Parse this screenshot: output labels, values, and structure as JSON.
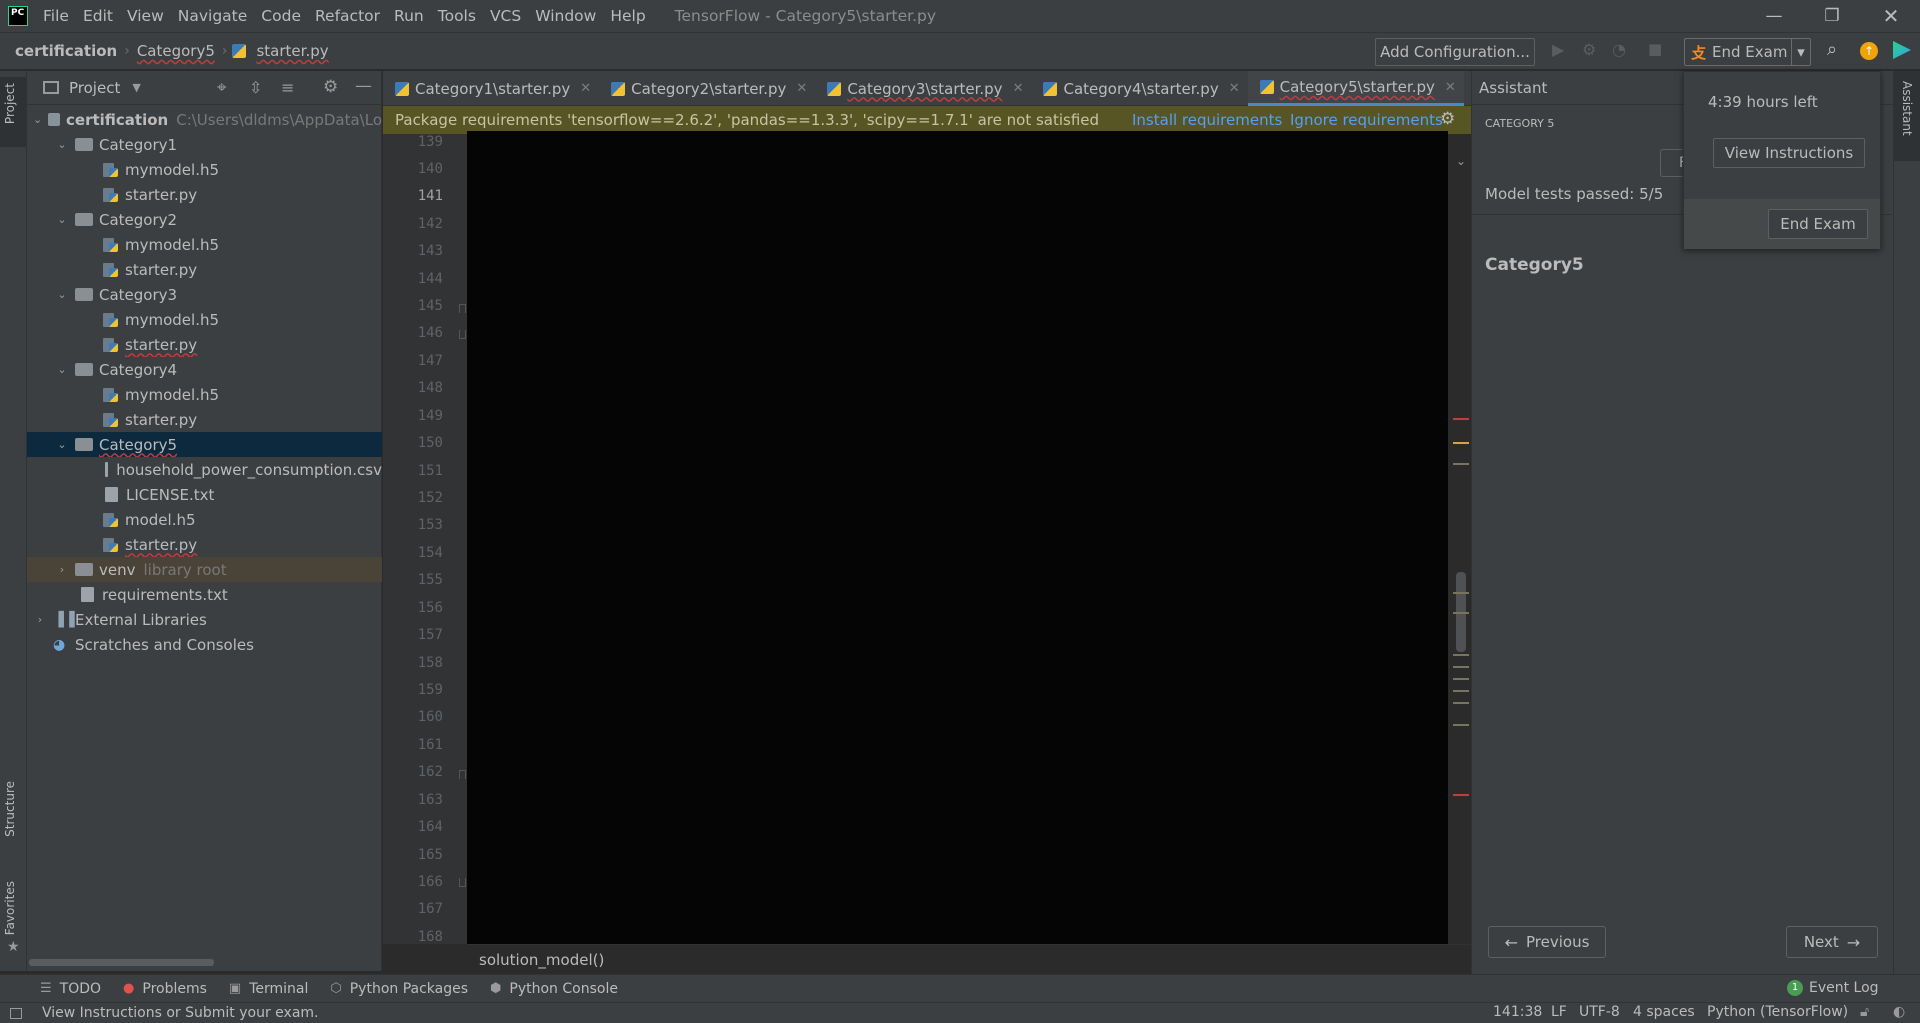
{
  "app": {
    "logo_text": "PC",
    "window_title": "TensorFlow - Category5\\starter.py",
    "menu": [
      "File",
      "Edit",
      "View",
      "Navigate",
      "Code",
      "Refactor",
      "Run",
      "Tools",
      "VCS",
      "Window",
      "Help"
    ]
  },
  "navbar": {
    "crumbs": [
      "certification",
      "Category5",
      "starter.py"
    ],
    "add_configuration": "Add Configuration...",
    "end_exam": "End Exam"
  },
  "left_strip": {
    "project": "Project",
    "structure": "Structure",
    "favorites": "Favorites"
  },
  "project_panel": {
    "title": "Project",
    "tree": [
      {
        "label": "certification",
        "hint": "C:\\Users\\dldms\\AppData\\Lo"
      },
      {
        "label": "Category1"
      },
      {
        "label": "mymodel.h5"
      },
      {
        "label": "starter.py"
      },
      {
        "label": "Category2"
      },
      {
        "label": "mymodel.h5"
      },
      {
        "label": "starter.py"
      },
      {
        "label": "Category3"
      },
      {
        "label": "mymodel.h5"
      },
      {
        "label": "starter.py"
      },
      {
        "label": "Category4"
      },
      {
        "label": "mymodel.h5"
      },
      {
        "label": "starter.py"
      },
      {
        "label": "Category5"
      },
      {
        "label": "household_power_consumption.csv"
      },
      {
        "label": "LICENSE.txt"
      },
      {
        "label": "model.h5"
      },
      {
        "label": "starter.py"
      },
      {
        "label": "venv",
        "hint": "library root"
      },
      {
        "label": "requirements.txt"
      },
      {
        "label": "External Libraries"
      },
      {
        "label": "Scratches and Consoles"
      }
    ]
  },
  "editor": {
    "tabs": [
      "Category1\\starter.py",
      "Category2\\starter.py",
      "Category3\\starter.py",
      "Category4\\starter.py",
      "Category5\\starter.py"
    ],
    "banner": {
      "message": "Package requirements 'tensorflow==2.6.2', 'pandas==1.3.3', 'scipy==1.7.1' are not satisfied",
      "install": "Install requirements",
      "ignore": "Ignore requirements"
    },
    "line_numbers": [
      "139",
      "140",
      "141",
      "142",
      "143",
      "144",
      "145",
      "146",
      "147",
      "148",
      "149",
      "150",
      "151",
      "152",
      "153",
      "154",
      "155",
      "156",
      "157",
      "158",
      "159",
      "160",
      "161",
      "162",
      "163",
      "164",
      "165",
      "166",
      "167",
      "168"
    ],
    "current_line": "141",
    "bottom_breadcrumb": "solution_model()"
  },
  "assistant": {
    "title": "Assistant",
    "category_caption": "CATEGORY 5",
    "tests_passed": "Model tests passed: 5/5",
    "heading": "Category5",
    "previous": "Previous",
    "next": "Next",
    "side_tab": "Assistant"
  },
  "exam_popup": {
    "time_left": "4:39 hours left",
    "view_instructions": "View Instructions",
    "end_exam": "End Exam"
  },
  "toolwindows": [
    "TODO",
    "Problems",
    "Terminal",
    "Python Packages",
    "Python Console"
  ],
  "event_log": {
    "count": "1",
    "label": "Event Log"
  },
  "statusbar": {
    "message": "View Instructions or Submit your exam.",
    "position": "141:38",
    "line_sep": "LF",
    "encoding": "UTF-8",
    "indent": "4 spaces",
    "interpreter": "Python (TensorFlow)"
  }
}
